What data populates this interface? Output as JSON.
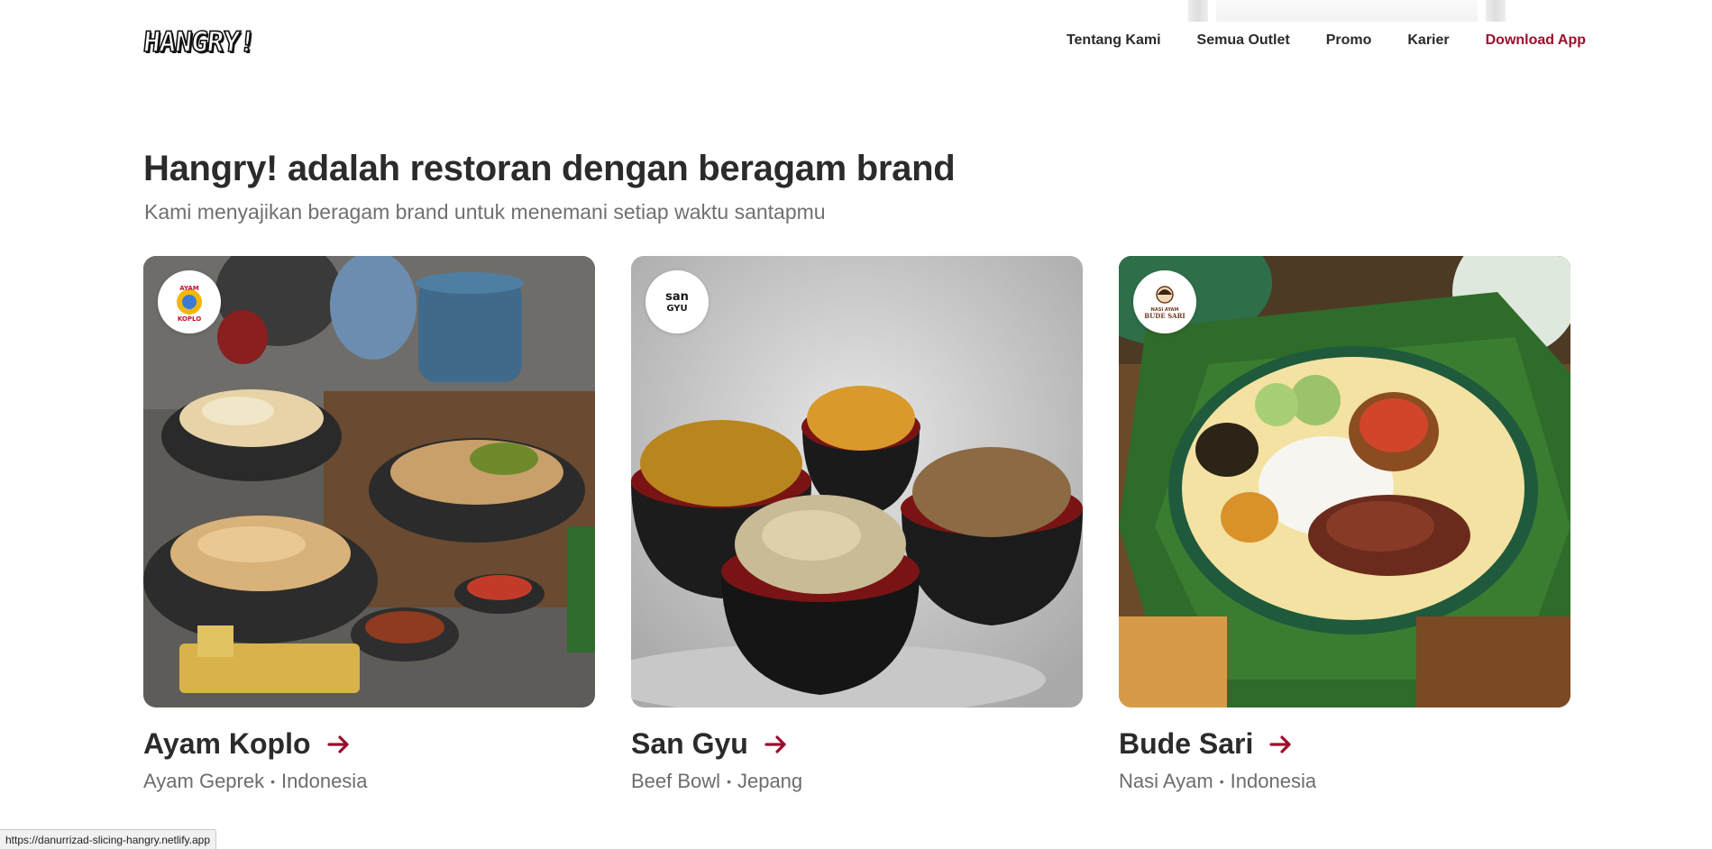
{
  "header": {
    "logo_text": "HANGRY!",
    "nav": [
      {
        "label": "Tentang Kami"
      },
      {
        "label": "Semua Outlet"
      },
      {
        "label": "Promo"
      },
      {
        "label": "Karier"
      },
      {
        "label": "Download App"
      }
    ]
  },
  "intro": {
    "title": "Hangry! adalah restoran dengan beragam brand",
    "subtitle": "Kami menyajikan beragam brand untuk menemani setiap waktu santapmu"
  },
  "brands": [
    {
      "name": "Ayam Koplo",
      "category": "Ayam Geprek",
      "origin": "Indonesia",
      "logo_text": "AYAM KOPLO"
    },
    {
      "name": "San Gyu",
      "category": "Beef Bowl",
      "origin": "Jepang",
      "logo_text": "SAN GYU"
    },
    {
      "name": "Bude Sari",
      "category": "Nasi Ayam",
      "origin": "Indonesia",
      "logo_text": "NASI AYAM BUDE SARI"
    }
  ],
  "meta_separator": "•",
  "colors": {
    "accent": "#9b0e2c",
    "text": "#2b2b2b",
    "muted": "#6d6d6d"
  },
  "status_bar": {
    "url": "https://danurrizad-slicing-hangry.netlify.app"
  }
}
